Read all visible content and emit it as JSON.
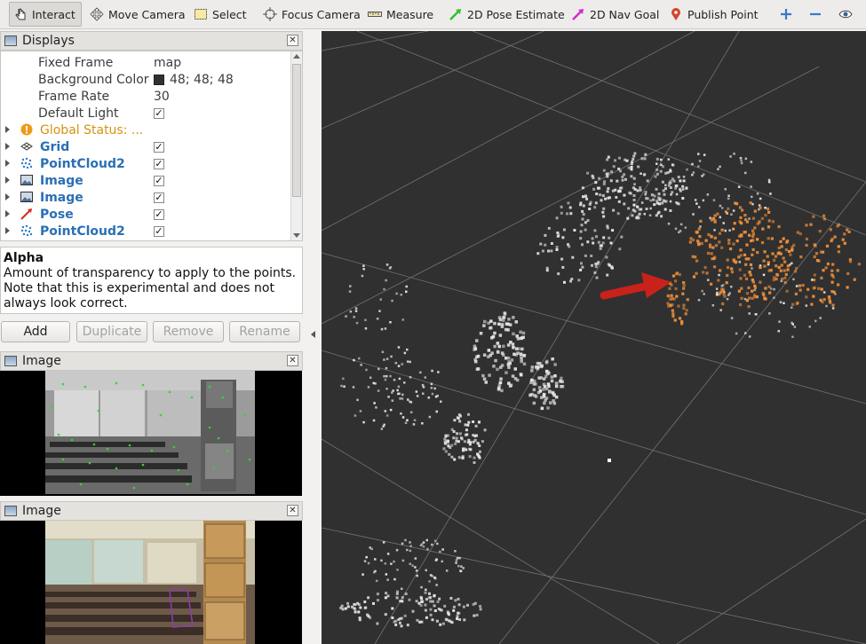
{
  "toolbar": {
    "interact": "Interact",
    "move_camera": "Move Camera",
    "select": "Select",
    "focus_camera": "Focus Camera",
    "measure": "Measure",
    "pose_estimate": "2D Pose Estimate",
    "nav_goal": "2D Nav Goal",
    "publish_point": "Publish Point"
  },
  "displays": {
    "title": "Displays",
    "fixed_frame_label": "Fixed Frame",
    "fixed_frame_value": "map",
    "bg_color_label": "Background Color",
    "bg_color_value": "48; 48; 48",
    "frame_rate_label": "Frame Rate",
    "frame_rate_value": "30",
    "default_light_label": "Default Light",
    "global_status": "Global Status: ...",
    "items": [
      {
        "name": "Grid",
        "icon": "grid-icon"
      },
      {
        "name": "PointCloud2",
        "icon": "pointcloud-icon"
      },
      {
        "name": "Image",
        "icon": "image-icon"
      },
      {
        "name": "Image",
        "icon": "image-icon"
      },
      {
        "name": "Pose",
        "icon": "pose-icon"
      },
      {
        "name": "PointCloud2",
        "icon": "pointcloud-icon"
      }
    ]
  },
  "help": {
    "title": "Alpha",
    "text": "Amount of transparency to apply to the points. Note that this is experimental and does not always look correct."
  },
  "buttons": {
    "add": "Add",
    "duplicate": "Duplicate",
    "remove": "Remove",
    "rename": "Rename"
  },
  "image_panel_1": {
    "title": "Image"
  },
  "image_panel_2": {
    "title": "Image"
  },
  "colors": {
    "background": "#303030",
    "point_white": "#e6e6e6",
    "point_orange": "#f0903a",
    "pose_arrow": "#c8221a",
    "grid": "#8c8c8c"
  }
}
